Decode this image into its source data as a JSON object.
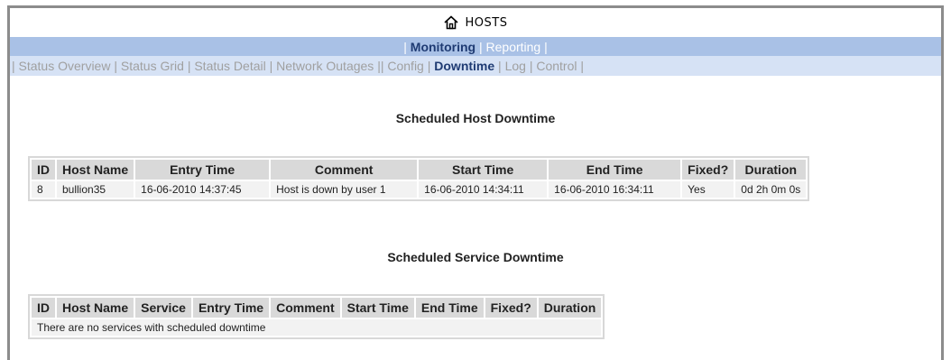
{
  "header": {
    "title": "HOSTS",
    "icon": "home-icon"
  },
  "nav_main": {
    "items": [
      "Monitoring",
      "Reporting"
    ],
    "active": "Monitoring"
  },
  "nav_sub": {
    "items": [
      "Status Overview",
      "Status Grid",
      "Status Detail",
      "Network Outages",
      "Config",
      "Downtime",
      "Log",
      "Control"
    ],
    "active": "Downtime"
  },
  "host_downtime": {
    "title": "Scheduled Host Downtime",
    "columns": [
      "ID",
      "Host Name",
      "Entry Time",
      "Comment",
      "Start Time",
      "End Time",
      "Fixed?",
      "Duration"
    ],
    "rows": [
      [
        "8",
        "bullion35",
        "16-06-2010 14:37:45",
        "Host is down by user 1",
        "16-06-2010 14:34:11",
        "16-06-2010 16:34:11",
        "Yes",
        "0d 2h 0m 0s"
      ]
    ]
  },
  "service_downtime": {
    "title": "Scheduled Service Downtime",
    "columns": [
      "ID",
      "Host Name",
      "Service",
      "Entry Time",
      "Comment",
      "Start Time",
      "End Time",
      "Fixed?",
      "Duration"
    ],
    "empty_message": "There are no services with scheduled downtime"
  },
  "colors": {
    "nav_main_bg": "#a9c1e6",
    "nav_sub_bg": "#d6e2f5",
    "active_link": "#1f3b73",
    "inactive_link": "#a0a0a0"
  }
}
